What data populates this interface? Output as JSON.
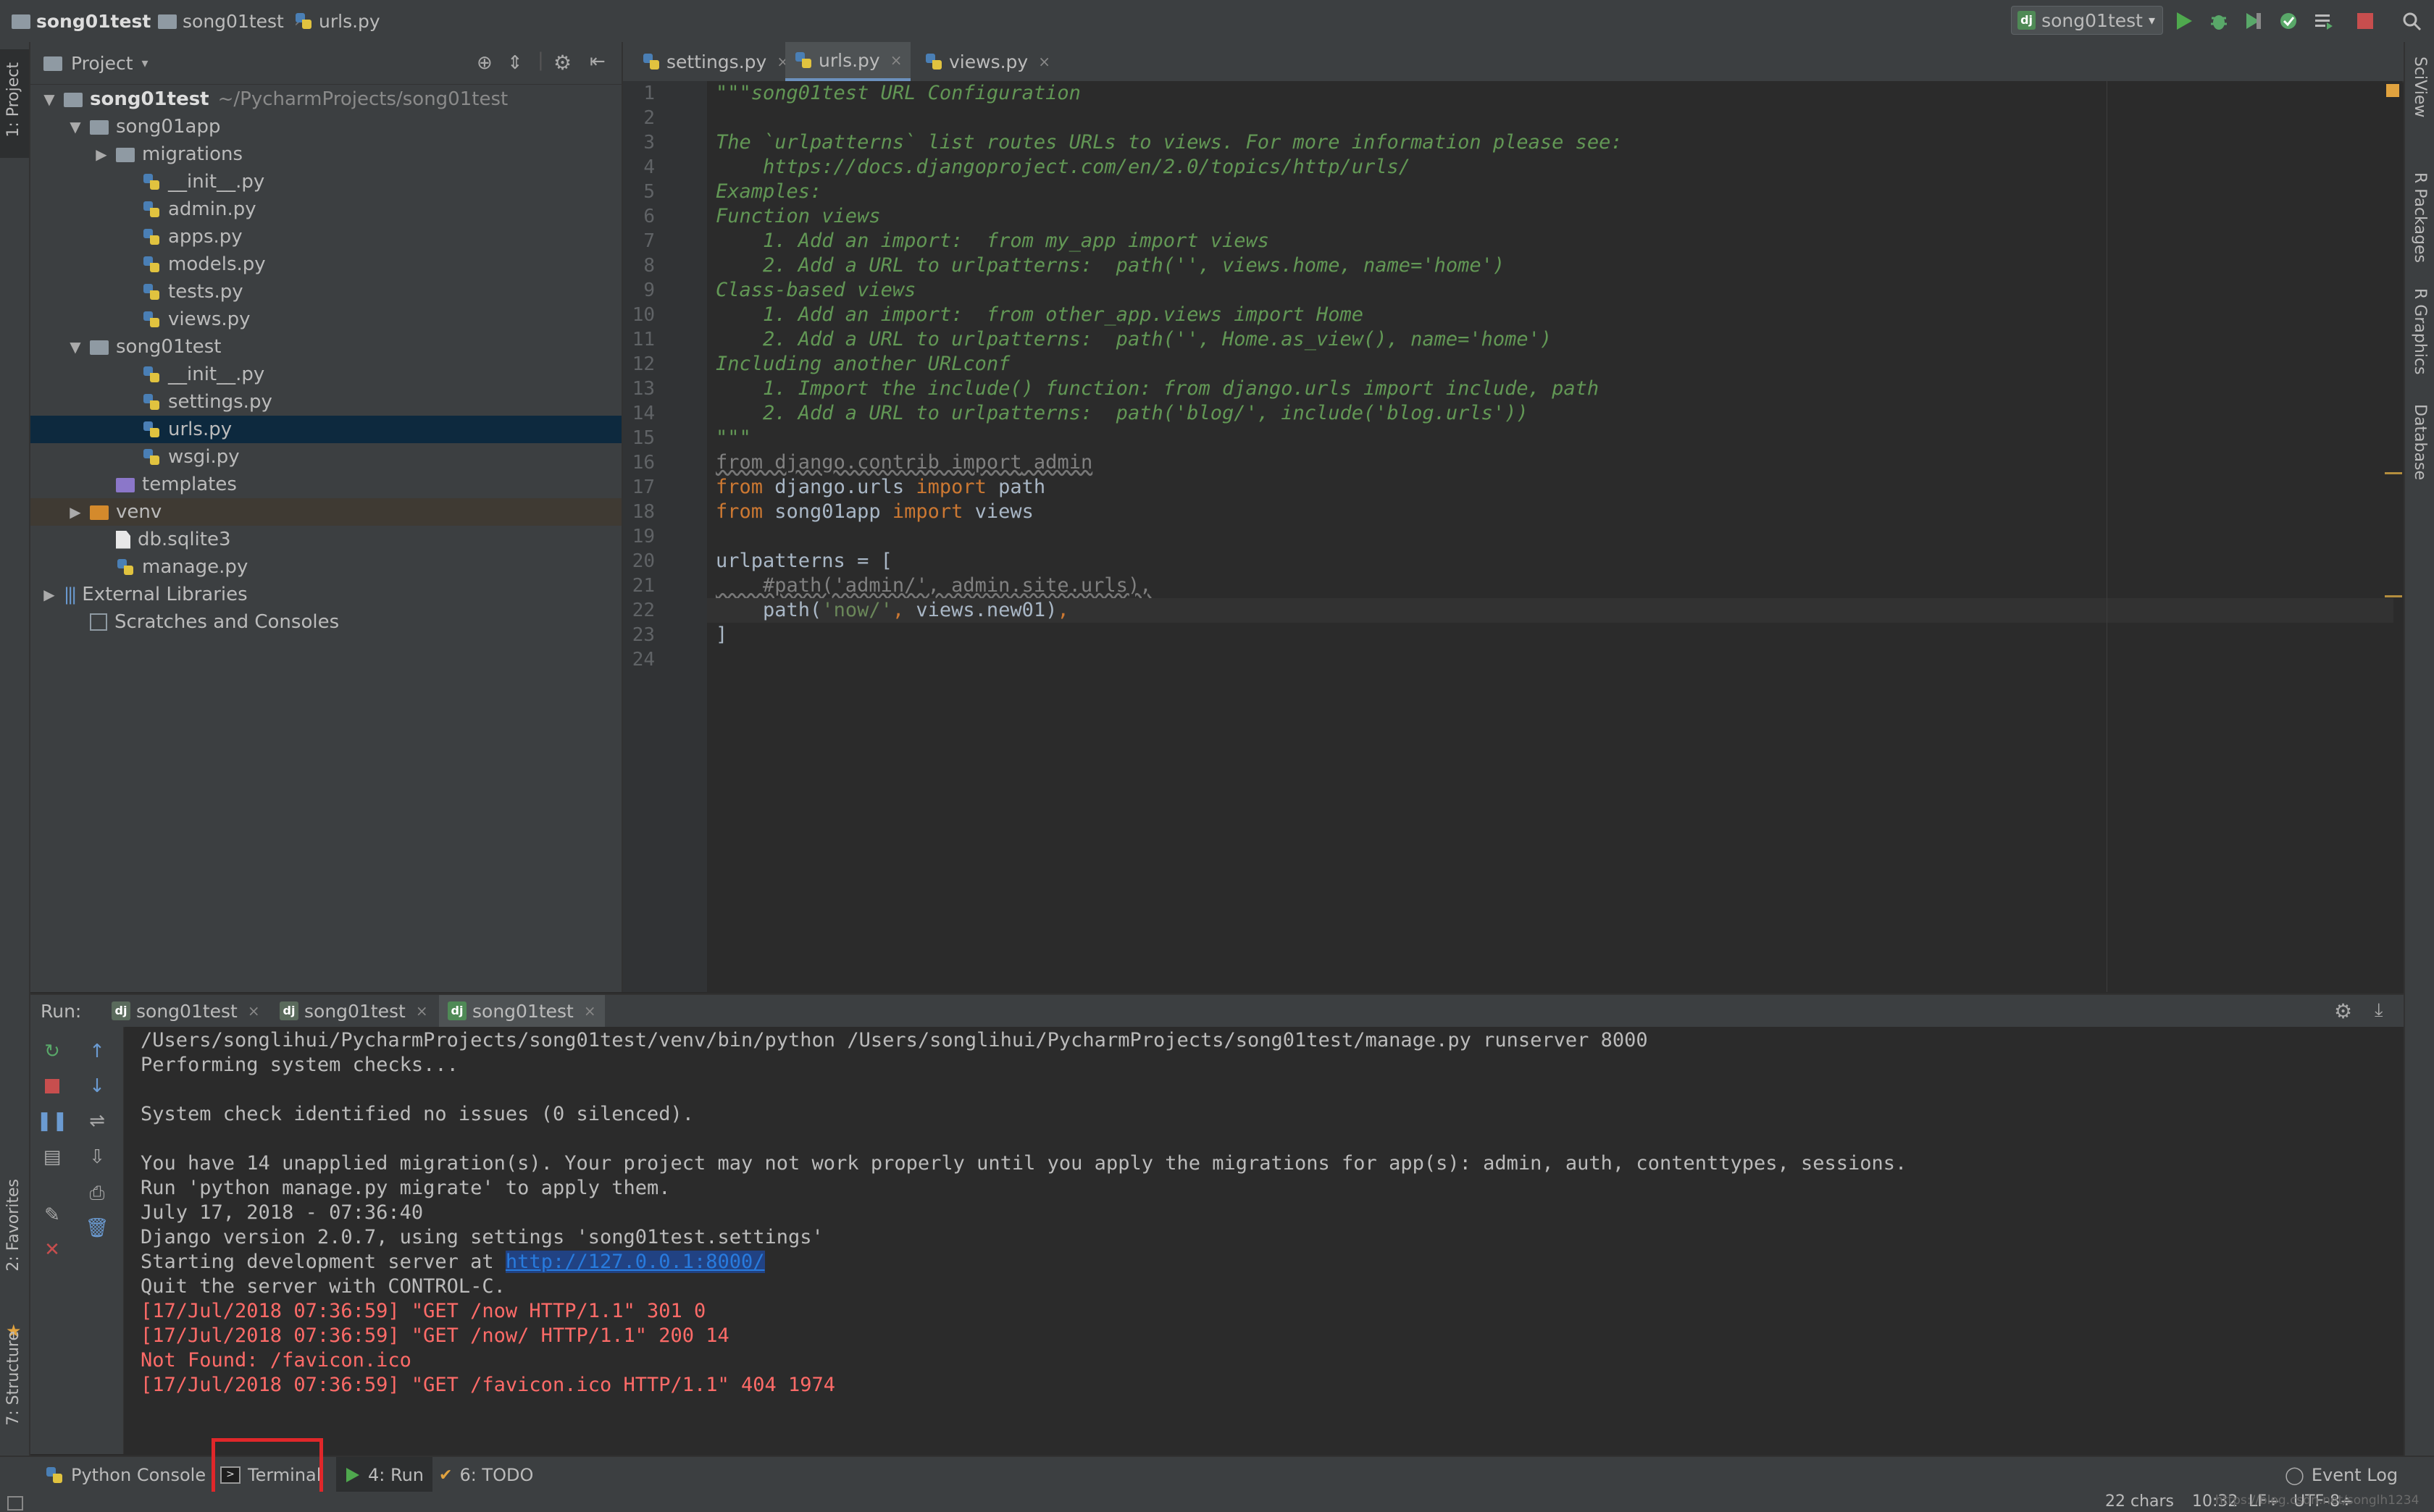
{
  "breadcrumb": {
    "root": "song01test",
    "folder": "song01test",
    "file": "urls.py"
  },
  "toolbar": {
    "run_config": "song01test",
    "colors": {
      "run": "#4fa94e",
      "debug": "#59a869",
      "stop": "#c74e4e"
    }
  },
  "left_strip": {
    "project_tab": "1: Project",
    "favorites_tab": "2: Favorites",
    "structure_tab": "7: Structure"
  },
  "right_strip": {
    "sciview": "SciView",
    "r_packages": "R Packages",
    "r_graphics": "R Graphics",
    "database": "Database"
  },
  "project": {
    "header": "Project",
    "tree": [
      {
        "label": "song01test",
        "path": "~/PycharmProjects/song01test",
        "icon": "folder-icon",
        "depth": 0,
        "toggle": "expanded"
      },
      {
        "label": "song01app",
        "icon": "folder-icon",
        "depth": 1,
        "toggle": "expanded"
      },
      {
        "label": "migrations",
        "icon": "folder-icon",
        "depth": 2,
        "toggle": "collapsed"
      },
      {
        "label": "__init__.py",
        "icon": "python-file-icon",
        "depth": 3
      },
      {
        "label": "admin.py",
        "icon": "python-file-icon",
        "depth": 3
      },
      {
        "label": "apps.py",
        "icon": "python-file-icon",
        "depth": 3
      },
      {
        "label": "models.py",
        "icon": "python-file-icon",
        "depth": 3
      },
      {
        "label": "tests.py",
        "icon": "python-file-icon",
        "depth": 3
      },
      {
        "label": "views.py",
        "icon": "python-file-icon",
        "depth": 3
      },
      {
        "label": "song01test",
        "icon": "folder-icon",
        "depth": 1,
        "toggle": "expanded"
      },
      {
        "label": "__init__.py",
        "icon": "python-file-icon",
        "depth": 3
      },
      {
        "label": "settings.py",
        "icon": "python-file-icon",
        "depth": 3
      },
      {
        "label": "urls.py",
        "icon": "python-file-icon",
        "depth": 3,
        "selected": true
      },
      {
        "label": "wsgi.py",
        "icon": "python-file-icon",
        "depth": 3
      },
      {
        "label": "templates",
        "icon": "template-folder-icon",
        "depth": 2
      },
      {
        "label": "venv",
        "icon": "excluded-folder-icon",
        "depth": 1,
        "toggle": "collapsed",
        "excluded": true
      },
      {
        "label": "db.sqlite3",
        "icon": "file-icon",
        "depth": 2
      },
      {
        "label": "manage.py",
        "icon": "python-file-icon",
        "depth": 2
      },
      {
        "label": "External Libraries",
        "icon": "library-icon",
        "depth": 0,
        "toggle": "collapsed"
      },
      {
        "label": "Scratches and Consoles",
        "icon": "scratches-icon",
        "depth": 1
      }
    ]
  },
  "editor": {
    "tabs": [
      {
        "label": "settings.py",
        "active": false
      },
      {
        "label": "urls.py",
        "active": true
      },
      {
        "label": "views.py",
        "active": false
      }
    ],
    "line_numbers": [
      "1",
      "2",
      "3",
      "4",
      "5",
      "6",
      "7",
      "8",
      "9",
      "10",
      "11",
      "12",
      "13",
      "14",
      "15",
      "16",
      "17",
      "18",
      "19",
      "20",
      "21",
      "22",
      "23",
      "24"
    ],
    "lines": [
      "\"\"\"song01test URL Configuration",
      "",
      "The `urlpatterns` list routes URLs to views. For more information please see:",
      "    https://docs.djangoproject.com/en/2.0/topics/http/urls/",
      "Examples:",
      "Function views",
      "    1. Add an import:  from my_app import views",
      "    2. Add a URL to urlpatterns:  path('', views.home, name='home')",
      "Class-based views",
      "    1. Add an import:  from other_app.views import Home",
      "    2. Add a URL to urlpatterns:  path('', Home.as_view(), name='home')",
      "Including another URLconf",
      "    1. Import the include() function: from django.urls import include, path",
      "    2. Add a URL to urlpatterns:  path('blog/', include('blog.urls'))",
      "\"\"\"",
      "from django.contrib import admin",
      "from django.urls import path",
      "from song01app import views",
      "",
      "urlpatterns = [",
      "    #path('admin/', admin.site.urls),",
      "    path('now/', views.new01),",
      "]",
      ""
    ],
    "tokens": {
      "from": "from",
      "import": "import",
      "l16_mod": " django.contrib ",
      "l16_name": " admin",
      "l17_mod": " django.urls ",
      "l17_name": " path",
      "l18_mod": " song01app ",
      "l18_name": " views",
      "l20": "urlpatterns = [",
      "l21": "    #path('admin/', admin.site.urls),",
      "l22_a": "    path(",
      "l22_str": "'now/'",
      "l22_comma": ",",
      "l22_b": " views.new01)",
      "l22_comma2": ",",
      "l23": "]"
    }
  },
  "run": {
    "label": "Run:",
    "tabs": [
      {
        "label": "song01test",
        "active": false
      },
      {
        "label": "song01test",
        "active": false
      },
      {
        "label": "song01test",
        "active": true
      }
    ],
    "console": [
      {
        "text": "/Users/songlihui/PycharmProjects/song01test/venv/bin/python /Users/songlihui/PycharmProjects/song01test/manage.py runserver 8000",
        "type": "normal"
      },
      {
        "text": "Performing system checks...",
        "type": "normal"
      },
      {
        "text": "",
        "type": "normal"
      },
      {
        "text": "System check identified no issues (0 silenced).",
        "type": "normal"
      },
      {
        "text": "",
        "type": "normal"
      },
      {
        "text": "You have 14 unapplied migration(s). Your project may not work properly until you apply the migrations for app(s): admin, auth, contenttypes, sessions.",
        "type": "normal"
      },
      {
        "text": "Run 'python manage.py migrate' to apply them.",
        "type": "normal"
      },
      {
        "text": "July 17, 2018 - 07:36:40",
        "type": "normal"
      },
      {
        "text": "Django version 2.0.7, using settings 'song01test.settings'",
        "type": "normal"
      },
      {
        "text": "Starting development server at ",
        "type": "link-line",
        "link": "http://127.0.0.1:8000/"
      },
      {
        "text": "Quit the server with CONTROL-C.",
        "type": "normal"
      },
      {
        "text": "[17/Jul/2018 07:36:59] \"GET /now HTTP/1.1\" 301 0",
        "type": "err"
      },
      {
        "text": "[17/Jul/2018 07:36:59] \"GET /now/ HTTP/1.1\" 200 14",
        "type": "err"
      },
      {
        "text": "Not Found: /favicon.ico",
        "type": "err"
      },
      {
        "text": "[17/Jul/2018 07:36:59] \"GET /favicon.ico HTTP/1.1\" 404 1974",
        "type": "err"
      }
    ]
  },
  "bottom_bar": {
    "python_console": "Python Console",
    "terminal": "Terminal",
    "run": "4: Run",
    "todo": "6: TODO",
    "event_log": "Event Log"
  },
  "status_bar": {
    "chars": "22 chars",
    "position": "10:32",
    "line_sep": "LF÷",
    "encoding": "UTF-8÷",
    "watermark": "https://blog.csdn.net/songlh1234"
  }
}
